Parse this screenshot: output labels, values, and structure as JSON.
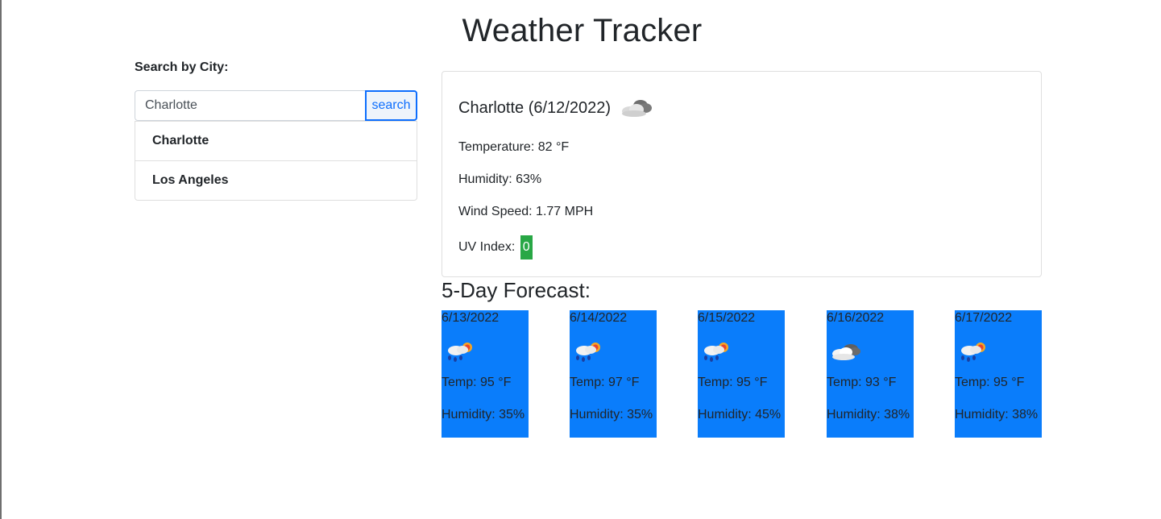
{
  "page": {
    "title": "Weather Tracker"
  },
  "search": {
    "label": "Search by City:",
    "value": "Charlotte",
    "placeholder": "",
    "button_label": "search"
  },
  "history": [
    {
      "label": "Charlotte"
    },
    {
      "label": "Los Angeles"
    }
  ],
  "current": {
    "heading": "Charlotte (6/12/2022)",
    "icon": "clouds-icon",
    "temperature": "Temperature: 82 °F",
    "humidity": "Humidity: 63%",
    "wind": "Wind Speed: 1.77 MPH",
    "uv_label": "UV Index:",
    "uv_value": "0",
    "uv_color": "#28a745"
  },
  "forecast": {
    "heading": "5-Day Forecast:",
    "card_color": "#0a7dfb",
    "days": [
      {
        "date": "6/13/2022",
        "icon": "rain-sun-icon",
        "temp": "Temp: 95 °F",
        "humidity": "Humidity: 35%"
      },
      {
        "date": "6/14/2022",
        "icon": "rain-sun-icon",
        "temp": "Temp: 97 °F",
        "humidity": "Humidity: 35%"
      },
      {
        "date": "6/15/2022",
        "icon": "rain-sun-icon",
        "temp": "Temp: 95 °F",
        "humidity": "Humidity: 45%"
      },
      {
        "date": "6/16/2022",
        "icon": "clouds-icon",
        "temp": "Temp: 93 °F",
        "humidity": "Humidity: 38%"
      },
      {
        "date": "6/17/2022",
        "icon": "rain-sun-icon",
        "temp": "Temp: 95 °F",
        "humidity": "Humidity: 38%"
      }
    ]
  }
}
